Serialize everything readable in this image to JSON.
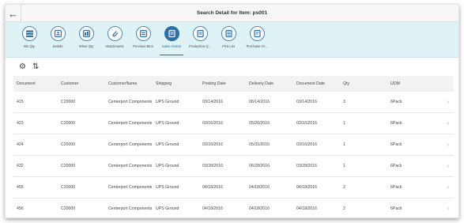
{
  "header": {
    "back_glyph": "←",
    "title": "Search Detail for Item: ps001"
  },
  "tiles": [
    {
      "label": "Bin Qty",
      "icon": "bin-qty-icon",
      "active": false
    },
    {
      "label": "Details",
      "icon": "details-icon",
      "active": false
    },
    {
      "label": "Whse Qty",
      "icon": "warehouse-qty-icon",
      "active": false
    },
    {
      "label": "Attachments",
      "icon": "attachments-icon",
      "active": false
    },
    {
      "label": "Previous Bins",
      "icon": "previous-bins-icon",
      "active": false
    },
    {
      "label": "Sales Orders",
      "icon": "sales-orders-icon",
      "active": true
    },
    {
      "label": "Production Q...",
      "icon": "production-icon",
      "active": false
    },
    {
      "label": "Pick List",
      "icon": "pick-list-icon",
      "active": false
    },
    {
      "label": "Purchase Or...",
      "icon": "purchase-orders-icon",
      "active": false
    }
  ],
  "toolbar": {
    "settings_icon": "gear-icon",
    "sort_icon": "sort-icon"
  },
  "colors": {
    "accent": "#2b6fa6",
    "iconbar_bg": "#dff3f7"
  },
  "table": {
    "columns": [
      "Document",
      "Customer",
      "CustomerName",
      "Shipping",
      "Posting Date",
      "Delivery Date",
      "Document Date",
      "Qty",
      "UOM"
    ],
    "rows": [
      [
        "415",
        "C20000",
        "Centerport Components",
        "UPS Ground",
        "03/14/2016",
        "06/14/2016",
        "03/14/2016",
        "3",
        "6Pack"
      ],
      [
        "423",
        "C20000",
        "Centerport Components",
        "UPS Ground",
        "03/16/2016",
        "05/26/2016",
        "03/16/2016",
        "1",
        "6Pack"
      ],
      [
        "424",
        "C20000",
        "Centerport Components",
        "UPS Ground",
        "03/16/2016",
        "05/31/2016",
        "03/16/2016",
        "1",
        "6Pack"
      ],
      [
        "432",
        "C20000",
        "Centerport Components",
        "UPS Ground",
        "03/28/2016",
        "06/28/2016",
        "03/28/2016",
        "1",
        "6Pack"
      ],
      [
        "455",
        "C20000",
        "Centerport Components",
        "UPS Ground",
        "04/18/2016",
        "04/18/2016",
        "04/18/2016",
        "2",
        "6Pack"
      ],
      [
        "456",
        "C20000",
        "Centerport Components",
        "UPS Ground",
        "04/18/2016",
        "04/18/2016",
        "04/18/2016",
        "2",
        "6Pack"
      ]
    ],
    "row_chevron": "›"
  }
}
